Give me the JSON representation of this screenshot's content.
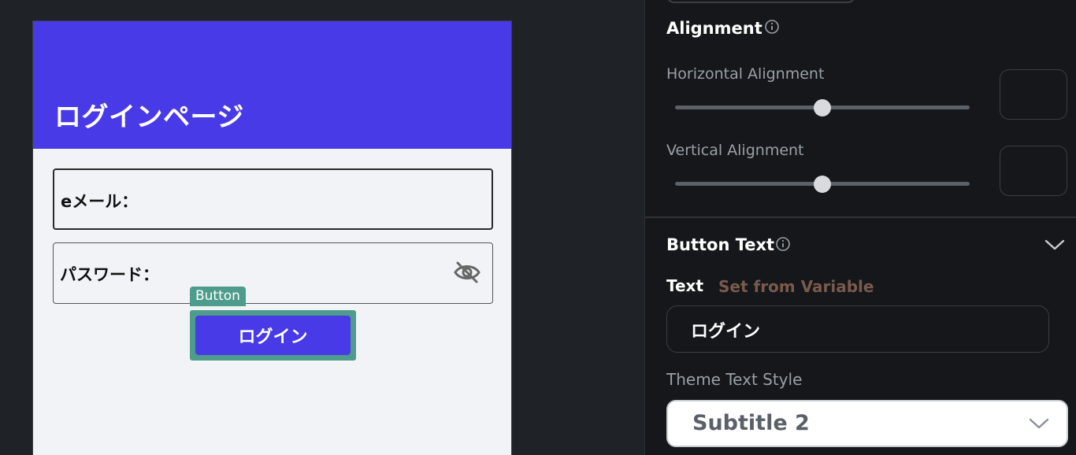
{
  "canvas": {
    "app_bar_title": "ログインページ",
    "email_label": "eメール：",
    "password_label": "パスワード：",
    "selection_tag": "Button",
    "login_button_label": "ログイン"
  },
  "panel": {
    "alignment": {
      "title": "Alignment",
      "horizontal_label": "Horizontal Alignment",
      "horizontal_value": 0.5,
      "vertical_label": "Vertical Alignment",
      "vertical_value": 0.5
    },
    "button_text": {
      "title": "Button Text",
      "text_label": "Text",
      "set_from_variable": "Set from Variable",
      "text_value": "ログイン",
      "theme_style_label": "Theme Text Style",
      "theme_style_value": "Subtitle 2"
    }
  },
  "colors": {
    "app_bar": "#483ae6",
    "selection": "#4e9c8c",
    "panel_bg": "#15171a",
    "canvas_bg": "#1f2226"
  }
}
